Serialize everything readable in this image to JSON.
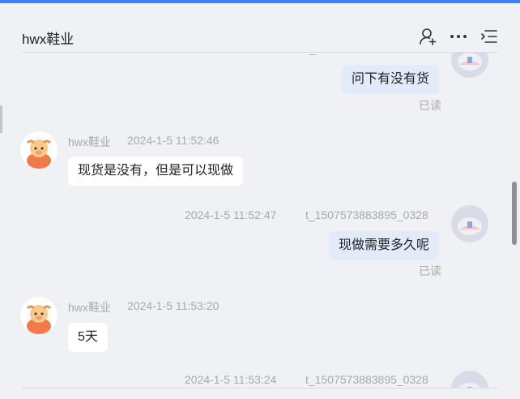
{
  "header": {
    "title": "hwx鞋业",
    "icons": [
      "add-user-icon",
      "more-icon",
      "menu-list-icon"
    ]
  },
  "messages": [
    {
      "id": "m1",
      "direction": "out",
      "text": "问下有没有货",
      "status": "已读"
    },
    {
      "id": "m2",
      "direction": "in",
      "sender": "hwx鞋业",
      "time": "2024-1-5 11:52:46",
      "text": "现货是没有，但是可以现做"
    },
    {
      "id": "m3",
      "direction": "out",
      "sender": "t_1507573883895_0328",
      "time": "2024-1-5 11:52:47",
      "text": "现做需要多久呢",
      "status": "已读"
    },
    {
      "id": "m4",
      "direction": "in",
      "sender": "hwx鞋业",
      "time": "2024-1-5 11:53:20",
      "text": "5天"
    },
    {
      "id": "m5",
      "direction": "out",
      "sender": "t_1507573883895_0328",
      "time": "2024-1-5 11:53:24"
    }
  ],
  "colors": {
    "accent": "#3b82f6",
    "background": "#f0f1f5",
    "outgoing_bubble": "#e3ebfb",
    "incoming_bubble": "#ffffff",
    "muted_text": "#a8a9ad"
  }
}
